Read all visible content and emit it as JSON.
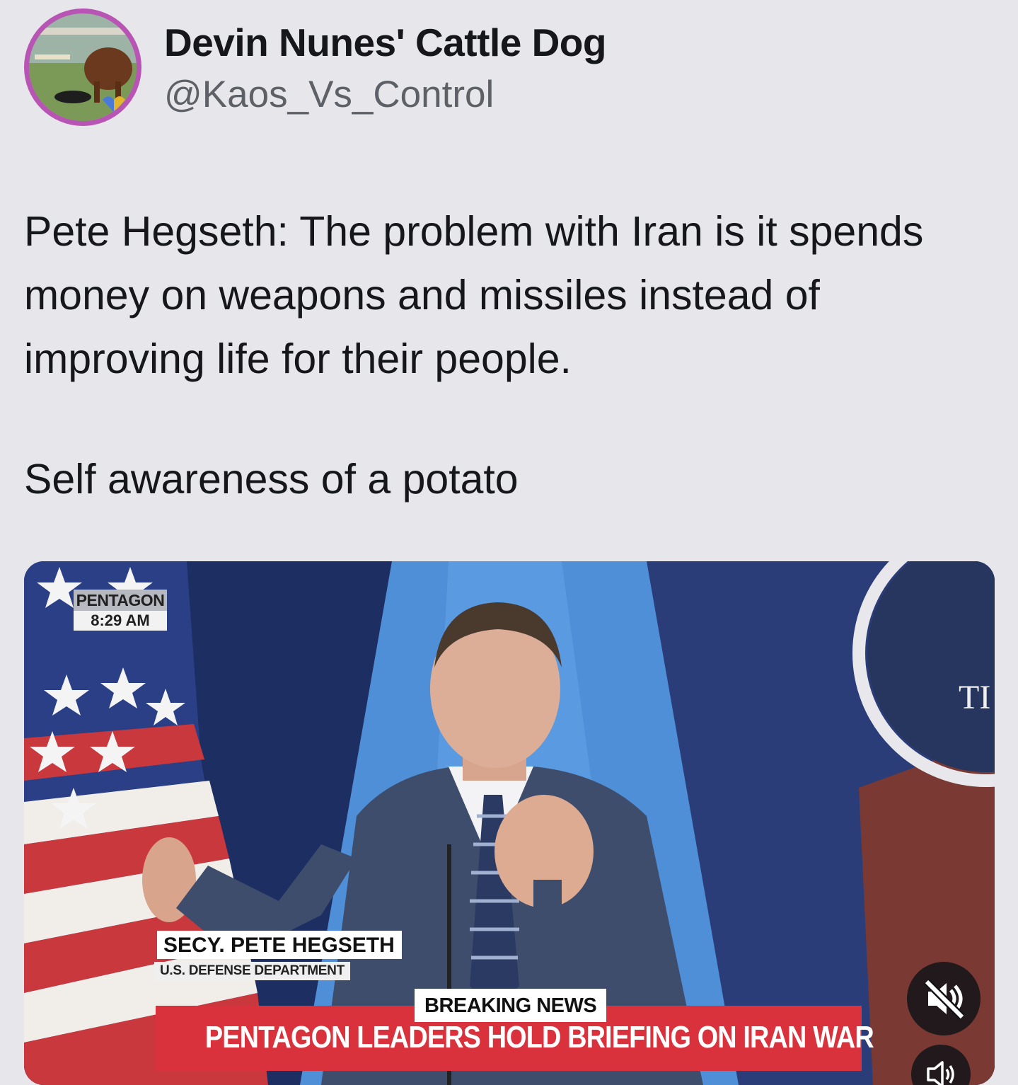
{
  "author": {
    "display_name": "Devin Nunes' Cattle Dog",
    "handle": "@Kaos_Vs_Control"
  },
  "tweet": {
    "paragraph_1": "Pete Hegseth: The problem with Iran is it spends money on weapons and missiles instead of improving life for their people.",
    "paragraph_2": "Self awareness of a potato"
  },
  "media": {
    "location": "PENTAGON",
    "time": "8:29 AM",
    "name_strap": "SECY. PETE HEGSETH",
    "org_strap": "U.S. DEFENSE DEPARTMENT",
    "breaking_label": "BREAKING NEWS",
    "headline": "PENTAGON LEADERS HOLD BRIEFING ON IRAN WAR",
    "seal_text": "TI",
    "controls": {
      "mute_icon": "speaker-muted-icon",
      "volume_icon": "speaker-icon"
    }
  },
  "colors": {
    "page_background": "#e7e6ea",
    "avatar_ring": "#b855b4",
    "handle_text": "#5d6066",
    "news_red": "#d9323c"
  }
}
